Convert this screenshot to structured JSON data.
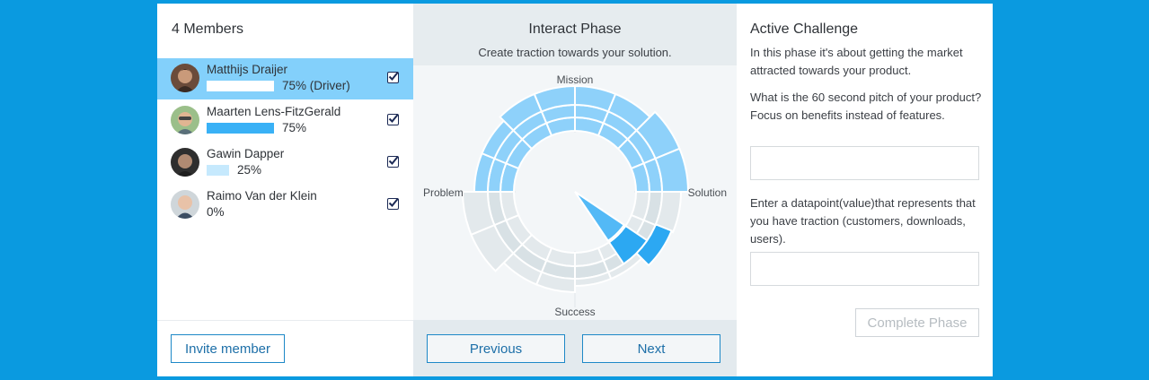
{
  "members": {
    "title": "4 Members",
    "list": [
      {
        "name": "Matthijs Draijer",
        "progress": 75,
        "pct_label": "75% (Driver)",
        "checked": true,
        "active": true
      },
      {
        "name": "Maarten Lens-FitzGerald",
        "progress": 75,
        "pct_label": "75%",
        "checked": true,
        "active": false
      },
      {
        "name": "Gawin Dapper",
        "progress": 25,
        "pct_label": "25%",
        "checked": true,
        "active": false
      },
      {
        "name": "Raimo Van der Klein",
        "progress": 0,
        "pct_label": "0%",
        "checked": true,
        "active": false
      }
    ],
    "invite_label": "Invite member"
  },
  "phase": {
    "title": "Interact Phase",
    "subtitle": "Create traction towards your solution.",
    "labels": {
      "top": "Mission",
      "right": "Solution",
      "bottom": "Success",
      "left": "Problem"
    },
    "previous_label": "Previous",
    "next_label": "Next"
  },
  "challenge": {
    "title": "Active Challenge",
    "intro": "In this phase it's about getting the market attracted towards your product.",
    "question1": "What is the 60 second pitch of your product? Focus on benefits instead of features.",
    "answer1": "",
    "question2": "Enter a datapoint(value)that represents that you have traction (customers, downloads, users).",
    "answer2": "",
    "complete_label": "Complete Phase"
  },
  "colors": {
    "background": "#0a9ae0",
    "active_row": "#83d0fb",
    "accent": "#1d88c7",
    "bar_white": "#ffffff",
    "bar_blue": "#39b1f6",
    "bar_light": "#c6e9fd",
    "wheel_blue": "#8ed1fa",
    "wheel_grey": "#e3e9ec",
    "wheel_grey_dark": "#d8e1e5",
    "wheel_current": "#2ca8f2",
    "wheel_current_light": "#53b9f6"
  }
}
